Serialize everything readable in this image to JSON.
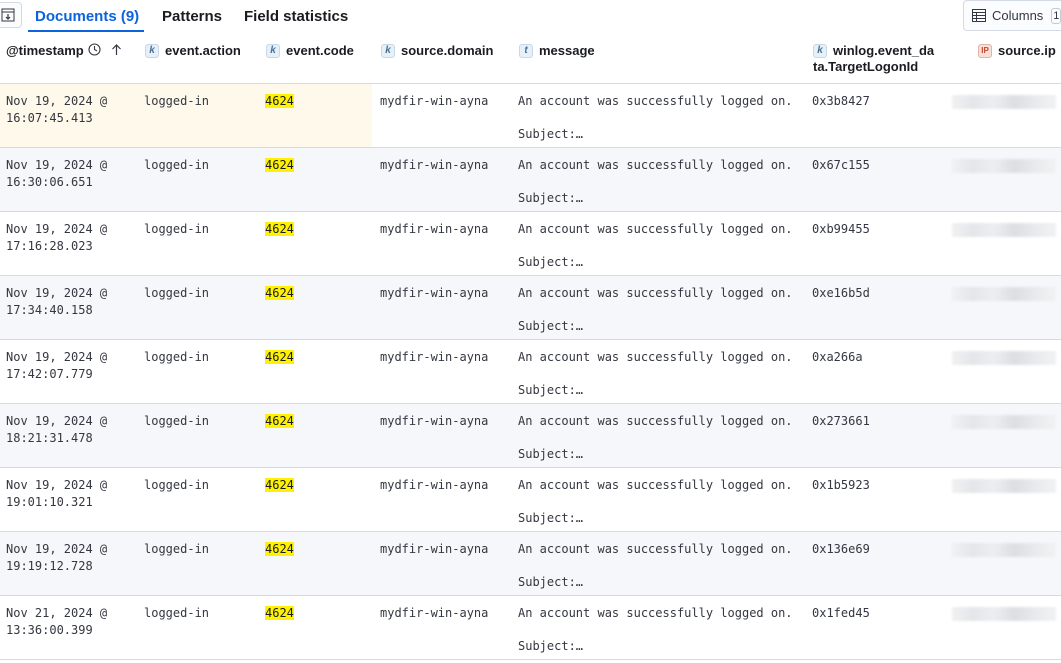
{
  "tabs": [
    {
      "label": "Documents (9)",
      "active": true
    },
    {
      "label": "Patterns",
      "active": false
    },
    {
      "label": "Field statistics",
      "active": false
    }
  ],
  "toolbar": {
    "columns_label": "Columns",
    "columns_count": "1"
  },
  "columns": [
    {
      "label": "@timestamp",
      "type": ""
    },
    {
      "label": "event.action",
      "type": "k"
    },
    {
      "label": "event.code",
      "type": "k"
    },
    {
      "label": "source.domain",
      "type": "k"
    },
    {
      "label": "message",
      "type": "t"
    },
    {
      "label": "winlog.event_da",
      "label2": "ta.TargetLogonId",
      "type": "k"
    },
    {
      "label": "source.ip",
      "type": "IP"
    }
  ],
  "rows": [
    {
      "ts1": "Nov 19, 2024 @",
      "ts2": "16:07:45.413",
      "action": "logged-in",
      "code": "4624",
      "domain": "mydfir-win-ayna",
      "msg1": "An account was successfully logged on.",
      "msg2": "Subject:…",
      "logon": "0x3b8427"
    },
    {
      "ts1": "Nov 19, 2024 @",
      "ts2": "16:30:06.651",
      "action": "logged-in",
      "code": "4624",
      "domain": "mydfir-win-ayna",
      "msg1": "An account was successfully logged on.",
      "msg2": "Subject:…",
      "logon": "0x67c155"
    },
    {
      "ts1": "Nov 19, 2024 @",
      "ts2": "17:16:28.023",
      "action": "logged-in",
      "code": "4624",
      "domain": "mydfir-win-ayna",
      "msg1": "An account was successfully logged on.",
      "msg2": "Subject:…",
      "logon": "0xb99455"
    },
    {
      "ts1": "Nov 19, 2024 @",
      "ts2": "17:34:40.158",
      "action": "logged-in",
      "code": "4624",
      "domain": "mydfir-win-ayna",
      "msg1": "An account was successfully logged on.",
      "msg2": "Subject:…",
      "logon": "0xe16b5d"
    },
    {
      "ts1": "Nov 19, 2024 @",
      "ts2": "17:42:07.779",
      "action": "logged-in",
      "code": "4624",
      "domain": "mydfir-win-ayna",
      "msg1": "An account was successfully logged on.",
      "msg2": "Subject:…",
      "logon": "0xa266a"
    },
    {
      "ts1": "Nov 19, 2024 @",
      "ts2": "18:21:31.478",
      "action": "logged-in",
      "code": "4624",
      "domain": "mydfir-win-ayna",
      "msg1": "An account was successfully logged on.",
      "msg2": "Subject:…",
      "logon": "0x273661"
    },
    {
      "ts1": "Nov 19, 2024 @",
      "ts2": "19:01:10.321",
      "action": "logged-in",
      "code": "4624",
      "domain": "mydfir-win-ayna",
      "msg1": "An account was successfully logged on.",
      "msg2": "Subject:…",
      "logon": "0x1b5923"
    },
    {
      "ts1": "Nov 19, 2024 @",
      "ts2": "19:19:12.728",
      "action": "logged-in",
      "code": "4624",
      "domain": "mydfir-win-ayna",
      "msg1": "An account was successfully logged on.",
      "msg2": "Subject:…",
      "logon": "0x136e69"
    },
    {
      "ts1": "Nov 21, 2024 @",
      "ts2": "13:36:00.399",
      "action": "logged-in",
      "code": "4624",
      "domain": "mydfir-win-ayna",
      "msg1": "An account was successfully logged on.",
      "msg2": "Subject:…",
      "logon": "0x1fed45"
    }
  ],
  "colors": {
    "accent": "#0b64dd",
    "highlight": "#fff200",
    "row_selected": "#fef9ea",
    "row_alt": "#f5f7fa"
  }
}
